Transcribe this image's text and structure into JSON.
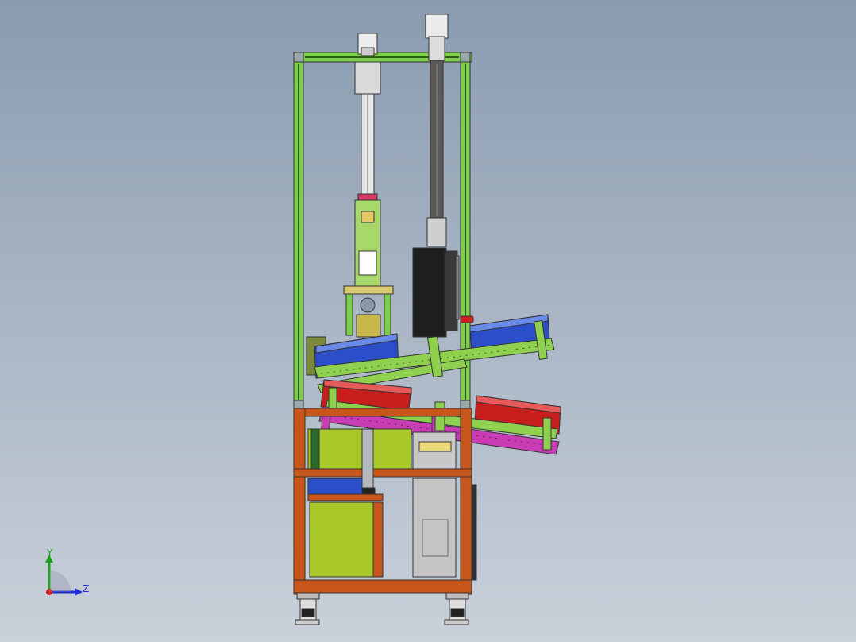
{
  "viewport": {
    "background_top": "#8a9bb0",
    "background_bottom": "#c9d1da"
  },
  "triad": {
    "y_label": "Y",
    "z_label": "Z",
    "x_color": "#d21e1e",
    "y_color": "#1ea01e",
    "z_color": "#1e2ad2"
  },
  "colors": {
    "frame_green": "#7ccf4a",
    "frame_dark": "#4a7a2a",
    "cabinet_orange": "#c8561b",
    "panel_olive": "#a8c82a",
    "tray_blue": "#2a4fc8",
    "tray_red": "#c81e1e",
    "rail_magenta": "#c83cb4",
    "rail_green": "#8fd14f",
    "cylinder_black": "#1e1e1e",
    "metal_gray": "#b4b8bc"
  }
}
